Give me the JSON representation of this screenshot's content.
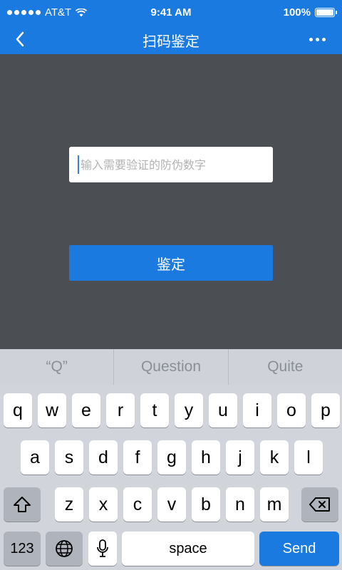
{
  "status_bar": {
    "carrier": "AT&T",
    "time": "9:41 AM",
    "battery": "100%"
  },
  "nav": {
    "title": "扫码鉴定"
  },
  "form": {
    "code_placeholder": "输入需要验证的防伪数字",
    "code_value": "",
    "verify_label": "鉴定"
  },
  "keyboard": {
    "predictions": [
      "“Q”",
      "Question",
      "Quite"
    ],
    "row1": [
      "q",
      "w",
      "e",
      "r",
      "t",
      "y",
      "u",
      "i",
      "o",
      "p"
    ],
    "row2": [
      "a",
      "s",
      "d",
      "f",
      "g",
      "h",
      "j",
      "k",
      "l"
    ],
    "row3": [
      "z",
      "x",
      "c",
      "v",
      "b",
      "n",
      "m"
    ],
    "numbers_label": "123",
    "space_label": "space",
    "send_label": "Send"
  },
  "colors": {
    "accent": "#1a7ae0",
    "background": "#4b4e53",
    "keyboard_bg": "#d1d5db"
  }
}
